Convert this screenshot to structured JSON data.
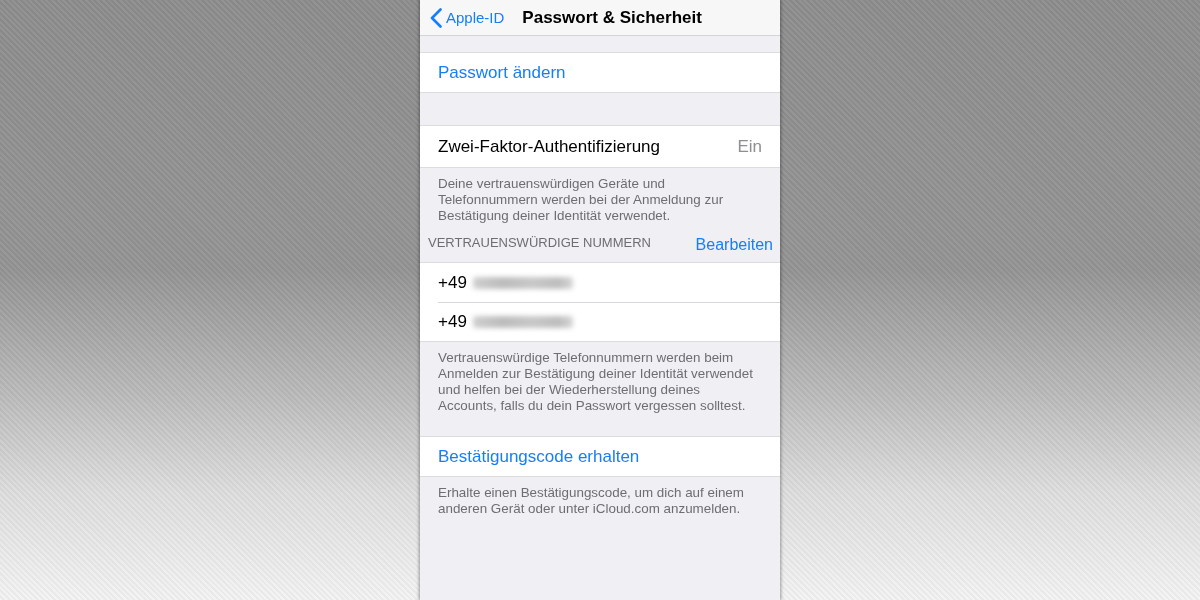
{
  "nav_bar": {
    "back_label": "Apple-ID",
    "title": "Passwort & Sicherheit"
  },
  "groups": [
    {
      "cells": [
        {
          "kind": "action",
          "label": "Passwort ändern"
        }
      ]
    },
    {
      "cells": [
        {
          "kind": "value",
          "label": "Zwei-Faktor-Authentifizierung",
          "value": "Ein"
        }
      ],
      "footer": "Deine vertrauenswürdigen Geräte und Telefonnummern werden bei der Anmeldung zur Bestätigung deiner Identität verwendet."
    },
    {
      "header": "VERTRAUENSWÜRDIGE NUMMERN",
      "header_action": "Bearbeiten",
      "cells": [
        {
          "kind": "phone",
          "label": "+49",
          "redacted": true
        },
        {
          "kind": "phone",
          "label": "+49",
          "redacted": true
        }
      ],
      "footer": "Vertrauenswürdige Telefonnummern werden beim Anmelden zur Bestätigung deiner Identität verwendet und helfen bei der Wiederherstellung deines Accounts, falls du dein Passwort vergessen solltest."
    },
    {
      "cells": [
        {
          "kind": "action",
          "label": "Bestätigungscode erhalten"
        }
      ],
      "footer": "Erhalte einen Bestätigungscode, um dich auf einem anderen Gerät oder unter iCloud.com anzumelden."
    }
  ]
}
